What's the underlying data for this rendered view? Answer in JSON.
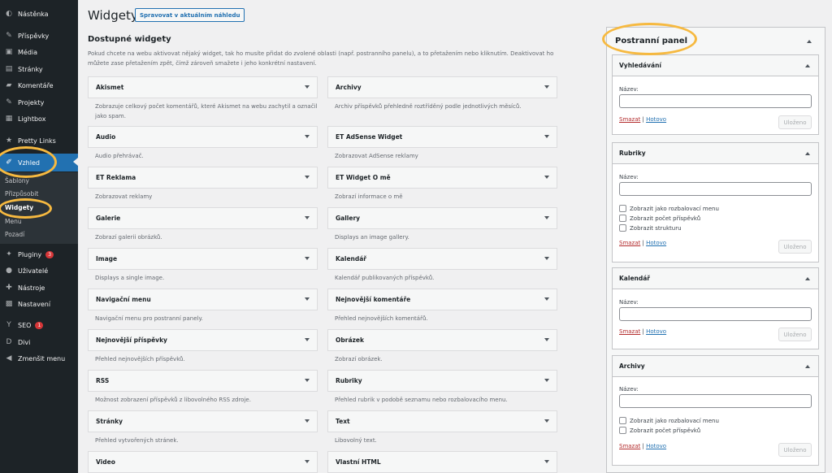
{
  "sidebar": {
    "items": [
      {
        "label": "Nástěnka",
        "icon": "dashboard-icon",
        "glyph": "◐"
      },
      {
        "label": "Příspěvky",
        "icon": "pin-icon",
        "glyph": "✎"
      },
      {
        "label": "Média",
        "icon": "media-icon",
        "glyph": "▣"
      },
      {
        "label": "Stránky",
        "icon": "pages-icon",
        "glyph": "▤"
      },
      {
        "label": "Komentáře",
        "icon": "comments-icon",
        "glyph": "▰"
      },
      {
        "label": "Projekty",
        "icon": "projects-icon",
        "glyph": "✎"
      },
      {
        "label": "Lightbox",
        "icon": "lightbox-icon",
        "glyph": "▦"
      },
      {
        "label": "Pretty Links",
        "icon": "link-icon",
        "glyph": "★"
      },
      {
        "label": "Vzhled",
        "icon": "brush-icon",
        "glyph": "✐"
      },
      {
        "label": "Pluginy",
        "icon": "plugin-icon",
        "glyph": "✦",
        "badge": "3"
      },
      {
        "label": "Uživatelé",
        "icon": "users-icon",
        "glyph": "●"
      },
      {
        "label": "Nástroje",
        "icon": "tools-icon",
        "glyph": "✚"
      },
      {
        "label": "Nastavení",
        "icon": "settings-icon",
        "glyph": "▩"
      },
      {
        "label": "SEO",
        "icon": "seo-icon",
        "glyph": "Y",
        "badge": "1"
      },
      {
        "label": "Divi",
        "icon": "divi-icon",
        "glyph": "D"
      },
      {
        "label": "Zmenšit menu",
        "icon": "collapse-icon",
        "glyph": "◀"
      }
    ],
    "submenu": [
      "Šablony",
      "Přizpůsobit",
      "Widgety",
      "Menu",
      "Pozadí"
    ]
  },
  "header": {
    "title": "Widgety",
    "manage_button": "Spravovat v aktuálním náhledu"
  },
  "available": {
    "heading": "Dostupné widgety",
    "description": "Pokud chcete na webu aktivovat nějaký widget, tak ho musíte přidat do zvolené oblasti (např. postranního panelu), a to přetažením nebo kliknutím. Deaktivovat ho můžete zase přetažením zpět, čímž zároveň smažete i jeho konkrétní nastavení.",
    "widgets": [
      {
        "title": "Akismet",
        "desc": "Zobrazuje celkový počet komentářů, které Akismet na webu zachytil a označil jako spam."
      },
      {
        "title": "Archivy",
        "desc": "Archiv příspěvků přehledně roztříděný podle jednotlivých měsíců."
      },
      {
        "title": "Audio",
        "desc": "Audio přehrávač."
      },
      {
        "title": "ET AdSense Widget",
        "desc": "Zobrazovat AdSense reklamy"
      },
      {
        "title": "ET Reklama",
        "desc": "Zobrazovat reklamy"
      },
      {
        "title": "ET Widget O mě",
        "desc": "Zobrazí informace o mě"
      },
      {
        "title": "Galerie",
        "desc": "Zobrazí galerii obrázků."
      },
      {
        "title": "Gallery",
        "desc": "Displays an image gallery."
      },
      {
        "title": "Image",
        "desc": "Displays a single image."
      },
      {
        "title": "Kalendář",
        "desc": "Kalendář publikovaných příspěvků."
      },
      {
        "title": "Navigační menu",
        "desc": "Navigační menu pro postranní panely."
      },
      {
        "title": "Nejnovější komentáře",
        "desc": "Přehled nejnovějších komentářů."
      },
      {
        "title": "Nejnovější příspěvky",
        "desc": "Přehled nejnovějších příspěvků."
      },
      {
        "title": "Obrázek",
        "desc": "Zobrazí obrázek."
      },
      {
        "title": "RSS",
        "desc": "Možnost zobrazení příspěvků z libovolného RSS zdroje."
      },
      {
        "title": "Rubriky",
        "desc": "Přehled rubrik v podobě seznamu nebo rozbalovacího menu."
      },
      {
        "title": "Stránky",
        "desc": "Přehled vytvořených stránek."
      },
      {
        "title": "Text",
        "desc": "Libovolný text."
      },
      {
        "title": "Video",
        "desc": ""
      },
      {
        "title": "Vlastní HTML",
        "desc": ""
      }
    ]
  },
  "panel": {
    "title": "Postranní panel",
    "widgets": [
      {
        "title": "Vyhledávání",
        "field_label": "Název:",
        "field_value": "",
        "checkboxes": [],
        "delete": "Smazat",
        "separator": "|",
        "done": "Hotovo",
        "save": "Uloženo"
      },
      {
        "title": "Rubriky",
        "field_label": "Název:",
        "field_value": "",
        "checkboxes": [
          "Zobrazit jako rozbalovací menu",
          "Zobrazit počet příspěvků",
          "Zobrazit strukturu"
        ],
        "delete": "Smazat",
        "separator": "|",
        "done": "Hotovo",
        "save": "Uloženo"
      },
      {
        "title": "Kalendář",
        "field_label": "Název:",
        "field_value": "",
        "checkboxes": [],
        "delete": "Smazat",
        "separator": "|",
        "done": "Hotovo",
        "save": "Uloženo"
      },
      {
        "title": "Archivy",
        "field_label": "Název:",
        "field_value": "",
        "checkboxes": [
          "Zobrazit jako rozbalovací menu",
          "Zobrazit počet příspěvků"
        ],
        "delete": "Smazat",
        "separator": "|",
        "done": "Hotovo",
        "save": "Uloženo"
      }
    ]
  },
  "colors": {
    "sidebar_bg": "#1d2327",
    "active_bg": "#2271b1",
    "highlight_ring": "#f6b940",
    "badge": "#d63638"
  }
}
